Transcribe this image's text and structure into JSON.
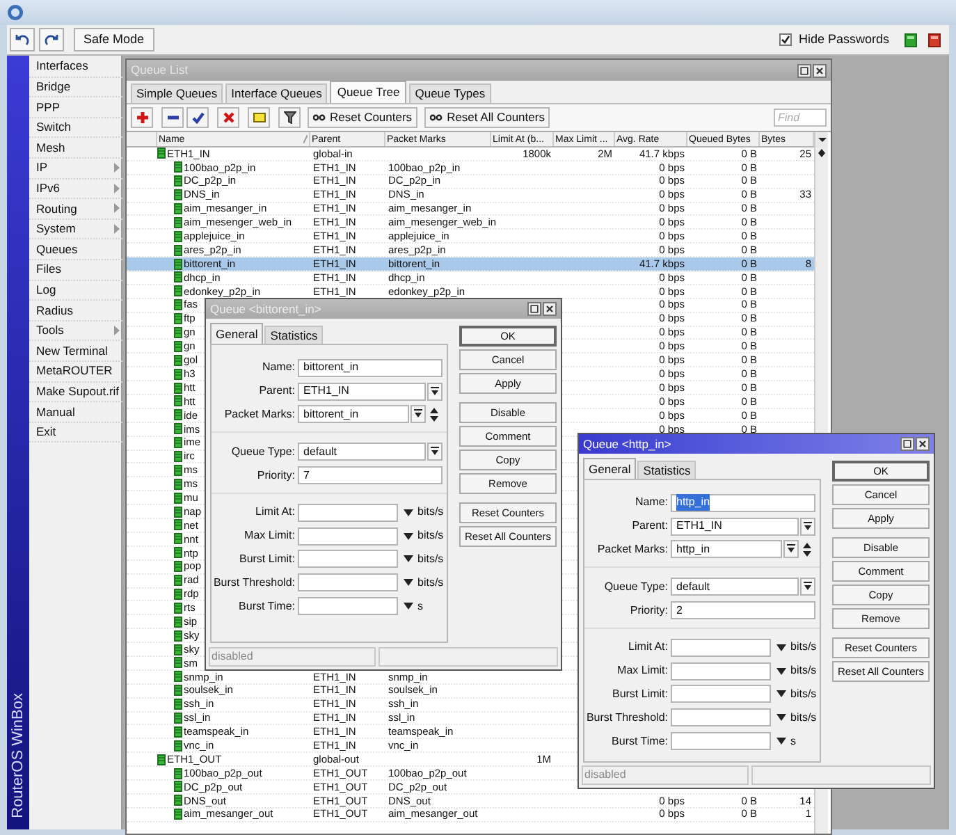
{
  "toolbar": {
    "safe_mode": "Safe Mode",
    "hide_passwords": {
      "label": "Hide Passwords",
      "checked": true
    }
  },
  "sidebar": {
    "brand": "RouterOS WinBox",
    "items": [
      {
        "label": "Interfaces",
        "submenu": false
      },
      {
        "label": "Bridge",
        "submenu": false
      },
      {
        "label": "PPP",
        "submenu": false
      },
      {
        "label": "Switch",
        "submenu": false
      },
      {
        "label": "Mesh",
        "submenu": false
      },
      {
        "label": "IP",
        "submenu": true
      },
      {
        "label": "IPv6",
        "submenu": true
      },
      {
        "label": "Routing",
        "submenu": true
      },
      {
        "label": "System",
        "submenu": true
      },
      {
        "label": "Queues",
        "submenu": false
      },
      {
        "label": "Files",
        "submenu": false
      },
      {
        "label": "Log",
        "submenu": false
      },
      {
        "label": "Radius",
        "submenu": false
      },
      {
        "label": "Tools",
        "submenu": true
      },
      {
        "label": "New Terminal",
        "submenu": false
      },
      {
        "label": "MetaROUTER",
        "submenu": false
      },
      {
        "label": "Make Supout.rif",
        "submenu": false
      },
      {
        "label": "Manual",
        "submenu": false
      },
      {
        "label": "Exit",
        "submenu": false
      }
    ]
  },
  "queue_list": {
    "title": "Queue List",
    "tabs": [
      {
        "label": "Simple Queues",
        "selected": false
      },
      {
        "label": "Interface Queues",
        "selected": false
      },
      {
        "label": "Queue Tree",
        "selected": true
      },
      {
        "label": "Queue Types",
        "selected": false
      }
    ],
    "actions": [
      "Reset Counters",
      "Reset All Counters"
    ],
    "find": {
      "placeholder": "Find"
    },
    "columns": [
      "Name",
      "Parent",
      "Packet Marks",
      "Limit At (b...",
      "Max Limit ...",
      "Avg. Rate",
      "Queued Bytes",
      "Bytes"
    ],
    "rows": [
      {
        "name": "ETH1_IN",
        "parent": "global-in",
        "limit_at": "1800k",
        "max_limit": "2M",
        "avg_rate": "41.7 kbps",
        "queued_bytes": "0 B",
        "bytes": "25",
        "selected": false,
        "children": [
          {
            "name": "100bao_p2p_in",
            "parent": "ETH1_IN",
            "packet_marks": "100bao_p2p_in",
            "avg_rate": "0 bps",
            "queued_bytes": "0 B",
            "selected": false
          },
          {
            "name": "DC_p2p_in",
            "parent": "ETH1_IN",
            "packet_marks": "DC_p2p_in",
            "avg_rate": "0 bps",
            "queued_bytes": "0 B",
            "selected": false
          },
          {
            "name": "DNS_in",
            "parent": "ETH1_IN",
            "packet_marks": "DNS_in",
            "avg_rate": "0 bps",
            "queued_bytes": "0 B",
            "bytes": "33",
            "selected": false
          },
          {
            "name": "aim_mesanger_in",
            "parent": "ETH1_IN",
            "packet_marks": "aim_mesanger_in",
            "avg_rate": "0 bps",
            "queued_bytes": "0 B",
            "selected": false
          },
          {
            "name": "aim_mesenger_web_in",
            "parent": "ETH1_IN",
            "packet_marks": "aim_mesenger_web_in",
            "avg_rate": "0 bps",
            "queued_bytes": "0 B",
            "selected": false
          },
          {
            "name": "applejuice_in",
            "parent": "ETH1_IN",
            "packet_marks": "applejuice_in",
            "avg_rate": "0 bps",
            "queued_bytes": "0 B",
            "selected": false
          },
          {
            "name": "ares_p2p_in",
            "parent": "ETH1_IN",
            "packet_marks": "ares_p2p_in",
            "avg_rate": "0 bps",
            "queued_bytes": "0 B",
            "selected": false
          },
          {
            "name": "bittorent_in",
            "parent": "ETH1_IN",
            "packet_marks": "bittorent_in",
            "avg_rate": "41.7 kbps",
            "queued_bytes": "0 B",
            "bytes": "8",
            "selected": true
          },
          {
            "name": "dhcp_in",
            "parent": "ETH1_IN",
            "packet_marks": "dhcp_in",
            "avg_rate": "0 bps",
            "queued_bytes": "0 B",
            "selected": false
          },
          {
            "name": "edonkey_p2p_in",
            "parent": "ETH1_IN",
            "packet_marks": "edonkey_p2p_in",
            "avg_rate": "0 bps",
            "queued_bytes": "0 B",
            "selected": false
          },
          {
            "name": "fas",
            "avg_rate": "0 bps",
            "queued_bytes": "0 B",
            "selected": false
          },
          {
            "name": "ftp",
            "avg_rate": "0 bps",
            "queued_bytes": "0 B",
            "selected": false
          },
          {
            "name": "gn",
            "avg_rate": "0 bps",
            "queued_bytes": "0 B",
            "selected": false
          },
          {
            "name": "gn",
            "avg_rate": "0 bps",
            "queued_bytes": "0 B",
            "selected": false
          },
          {
            "name": "gol",
            "avg_rate": "0 bps",
            "queued_bytes": "0 B",
            "selected": false
          },
          {
            "name": "h3",
            "avg_rate": "0 bps",
            "queued_bytes": "0 B",
            "selected": false
          },
          {
            "name": "htt",
            "avg_rate": "0 bps",
            "queued_bytes": "0 B",
            "selected": false
          },
          {
            "name": "htt",
            "avg_rate": "0 bps",
            "queued_bytes": "0 B",
            "selected": false
          },
          {
            "name": "ide",
            "avg_rate": "0 bps",
            "queued_bytes": "0 B",
            "selected": false
          },
          {
            "name": "ims",
            "avg_rate": "0 bps",
            "queued_bytes": "0 B",
            "selected": false
          },
          {
            "name": "ime",
            "selected": false
          },
          {
            "name": "irc",
            "selected": false
          },
          {
            "name": "ms",
            "selected": false
          },
          {
            "name": "ms",
            "selected": false
          },
          {
            "name": "mu",
            "selected": false
          },
          {
            "name": "nap",
            "selected": false
          },
          {
            "name": "net",
            "selected": false
          },
          {
            "name": "nnt",
            "selected": false
          },
          {
            "name": "ntp",
            "selected": false
          },
          {
            "name": "pop",
            "selected": false
          },
          {
            "name": "rad",
            "selected": false
          },
          {
            "name": "rdp",
            "selected": false
          },
          {
            "name": "rts",
            "selected": false
          },
          {
            "name": "sip",
            "selected": false
          },
          {
            "name": "sky",
            "selected": false
          },
          {
            "name": "sky",
            "selected": false
          },
          {
            "name": "sm",
            "selected": false
          },
          {
            "name": "snmp_in",
            "parent": "ETH1_IN",
            "packet_marks": "snmp_in",
            "selected": false
          },
          {
            "name": "soulsek_in",
            "parent": "ETH1_IN",
            "packet_marks": "soulsek_in",
            "selected": false
          },
          {
            "name": "ssh_in",
            "parent": "ETH1_IN",
            "packet_marks": "ssh_in",
            "selected": false
          },
          {
            "name": "ssl_in",
            "parent": "ETH1_IN",
            "packet_marks": "ssl_in",
            "selected": false
          },
          {
            "name": "teamspeak_in",
            "parent": "ETH1_IN",
            "packet_marks": "teamspeak_in",
            "selected": false
          },
          {
            "name": "vnc_in",
            "parent": "ETH1_IN",
            "packet_marks": "vnc_in",
            "selected": false
          }
        ]
      },
      {
        "name": "ETH1_OUT",
        "parent": "global-out",
        "limit_at": "1M",
        "selected": false,
        "children": [
          {
            "name": "100bao_p2p_out",
            "parent": "ETH1_OUT",
            "packet_marks": "100bao_p2p_out",
            "selected": false
          },
          {
            "name": "DC_p2p_out",
            "parent": "ETH1_OUT",
            "packet_marks": "DC_p2p_out",
            "selected": false
          },
          {
            "name": "DNS_out",
            "parent": "ETH1_OUT",
            "packet_marks": "DNS_out",
            "avg_rate": "0 bps",
            "queued_bytes": "0 B",
            "bytes": "14",
            "selected": false
          },
          {
            "name": "aim_mesanger_out",
            "parent": "ETH1_OUT",
            "packet_marks": "aim_mesanger_out",
            "avg_rate": "0 bps",
            "queued_bytes": "0 B",
            "bytes": "1",
            "selected": false
          }
        ]
      }
    ]
  },
  "dialogs": [
    {
      "title": "Queue <bittorent_in>",
      "active": false,
      "tabs": [
        {
          "label": "General",
          "selected": true
        },
        {
          "label": "Statistics",
          "selected": false
        }
      ],
      "groups": [
        [
          {
            "label": "Name:",
            "kind": "text",
            "value": "bittorent_in",
            "highlighted": false
          },
          {
            "label": "Parent:",
            "kind": "dropdown",
            "value": "ETH1_IN"
          },
          {
            "label": "Packet Marks:",
            "kind": "marks",
            "value": "bittorent_in"
          }
        ],
        [
          {
            "label": "Queue Type:",
            "kind": "dropdown",
            "value": "default"
          },
          {
            "label": "Priority:",
            "kind": "text",
            "value": "7"
          }
        ],
        [
          {
            "label": "Limit At:",
            "kind": "limit",
            "unit": "bits/s"
          },
          {
            "label": "Max Limit:",
            "kind": "limit",
            "unit": "bits/s"
          },
          {
            "label": "Burst Limit:",
            "kind": "limit",
            "unit": "bits/s"
          },
          {
            "label": "Burst Threshold:",
            "kind": "limit",
            "unit": "bits/s"
          },
          {
            "label": "Burst Time:",
            "kind": "limit",
            "unit": "s"
          }
        ]
      ],
      "button_groups": [
        [
          "OK",
          "Cancel",
          "Apply"
        ],
        [
          "Disable",
          "Comment",
          "Copy",
          "Remove"
        ],
        [
          "Reset Counters",
          "Reset All Counters"
        ]
      ],
      "status": "disabled"
    },
    {
      "title": "Queue <http_in>",
      "active": true,
      "tabs": [
        {
          "label": "General",
          "selected": true
        },
        {
          "label": "Statistics",
          "selected": false
        }
      ],
      "groups": [
        [
          {
            "label": "Name:",
            "kind": "text",
            "value": "http_in",
            "highlighted": true
          },
          {
            "label": "Parent:",
            "kind": "dropdown",
            "value": "ETH1_IN"
          },
          {
            "label": "Packet Marks:",
            "kind": "marks",
            "value": "http_in"
          }
        ],
        [
          {
            "label": "Queue Type:",
            "kind": "dropdown",
            "value": "default"
          },
          {
            "label": "Priority:",
            "kind": "text",
            "value": "2"
          }
        ],
        [
          {
            "label": "Limit At:",
            "kind": "limit",
            "unit": "bits/s"
          },
          {
            "label": "Max Limit:",
            "kind": "limit",
            "unit": "bits/s"
          },
          {
            "label": "Burst Limit:",
            "kind": "limit",
            "unit": "bits/s"
          },
          {
            "label": "Burst Threshold:",
            "kind": "limit",
            "unit": "bits/s"
          },
          {
            "label": "Burst Time:",
            "kind": "limit",
            "unit": "s"
          }
        ]
      ],
      "button_groups": [
        [
          "OK",
          "Cancel",
          "Apply"
        ],
        [
          "Disable",
          "Comment",
          "Copy",
          "Remove"
        ],
        [
          "Reset Counters",
          "Reset All Counters"
        ]
      ],
      "status": "disabled"
    }
  ]
}
